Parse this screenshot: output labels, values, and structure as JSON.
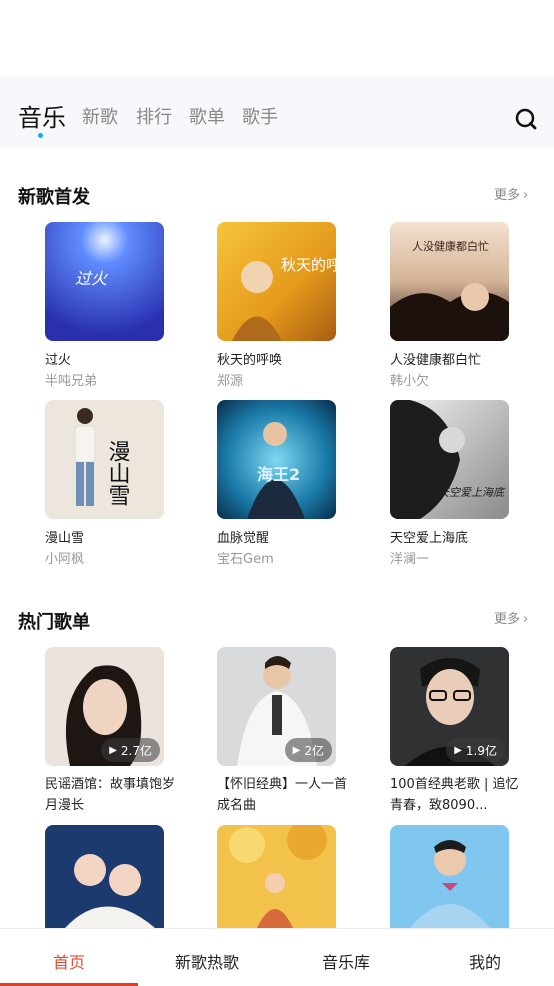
{
  "tabs": [
    {
      "label": "音乐"
    },
    {
      "label": "新歌"
    },
    {
      "label": "排行"
    },
    {
      "label": "歌单"
    },
    {
      "label": "歌手"
    }
  ],
  "new_releases": {
    "title": "新歌首发",
    "more": "更多",
    "items": [
      {
        "title": "过火",
        "artist": "半吨兄弟",
        "cover_text": "过火"
      },
      {
        "title": "秋天的呼唤",
        "artist": "郑源",
        "cover_text": "秋天的呼唤"
      },
      {
        "title": "人没健康都白忙",
        "artist": "韩小欠",
        "cover_text": "人没健康都白忙"
      },
      {
        "title": "漫山雪",
        "artist": "小阿枫",
        "cover_text": "漫山雪"
      },
      {
        "title": "血脉觉醒",
        "artist": "宝石Gem",
        "cover_text": "海王2"
      },
      {
        "title": "天空爱上海底",
        "artist": "洋澜一",
        "cover_text": "天空爱上海底"
      }
    ]
  },
  "hot_playlists": {
    "title": "热门歌单",
    "more": "更多",
    "items": [
      {
        "title": "民谣酒馆：故事填饱岁月漫长",
        "plays": "2.7亿"
      },
      {
        "title": "【怀旧经典】一人一首成名曲",
        "plays": "2亿"
      },
      {
        "title": "100首经典老歌 | 追忆青春，致8090...",
        "plays": "1.9亿"
      }
    ]
  },
  "bottom_nav": [
    {
      "label": "首页"
    },
    {
      "label": "新歌热歌"
    },
    {
      "label": "音乐库"
    },
    {
      "label": "我的"
    }
  ],
  "colors": {
    "accent": "#e23b2a",
    "tab_dot": "#1aa3ef"
  }
}
